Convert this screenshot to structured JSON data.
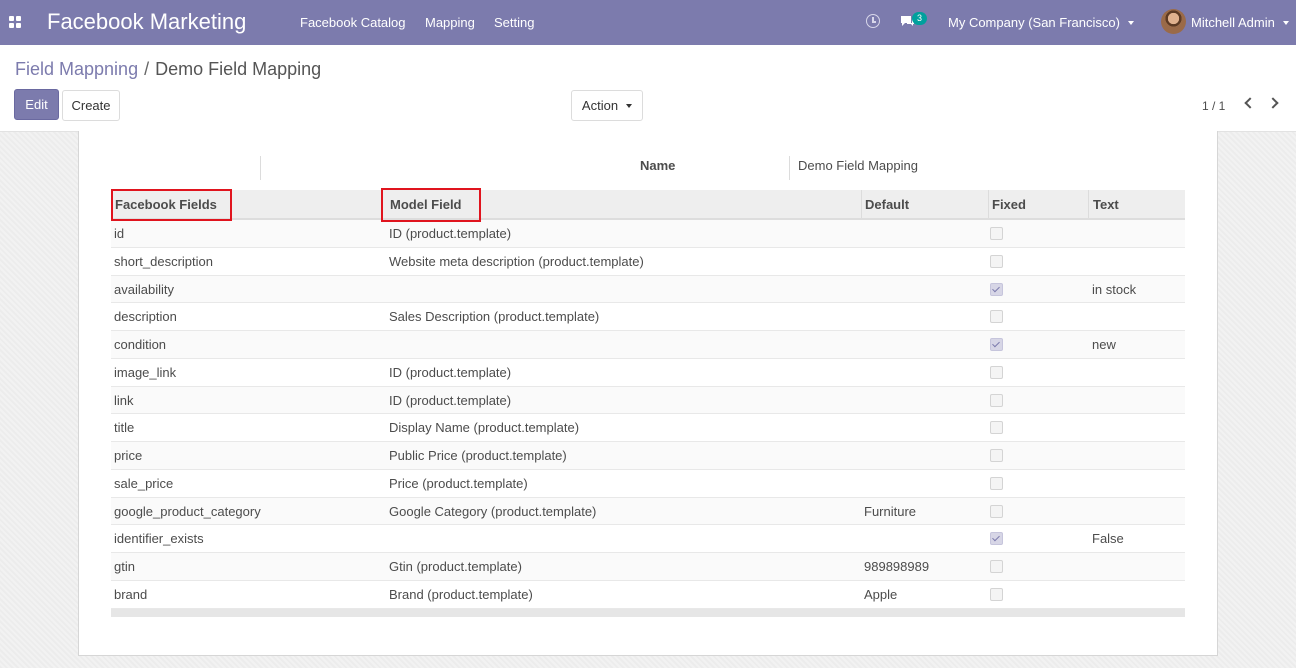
{
  "navbar": {
    "brand": "Facebook Marketing",
    "menu": [
      "Facebook Catalog",
      "Mapping",
      "Setting"
    ],
    "chat_count": "3",
    "company": "My Company (San Francisco)",
    "user": "Mitchell Admin",
    "color": "#7c7bad"
  },
  "breadcrumb": {
    "parent": "Field Mappning",
    "separator": "/",
    "current": "Demo Field Mapping"
  },
  "buttons": {
    "edit": "Edit",
    "create": "Create",
    "action": "Action"
  },
  "pager": "1 / 1",
  "form": {
    "name_label": "Name",
    "name_value": "Demo Field Mapping"
  },
  "table": {
    "headers": [
      "Facebook Fields",
      "Model Field",
      "Default",
      "Fixed",
      "Text"
    ],
    "rows": [
      {
        "facebook_field": "id",
        "model_field": "ID (product.template)",
        "default": "",
        "fixed": false,
        "text": ""
      },
      {
        "facebook_field": "short_description",
        "model_field": "Website meta description (product.template)",
        "default": "",
        "fixed": false,
        "text": ""
      },
      {
        "facebook_field": "availability",
        "model_field": "",
        "default": "",
        "fixed": true,
        "text": "in stock"
      },
      {
        "facebook_field": "description",
        "model_field": "Sales Description (product.template)",
        "default": "",
        "fixed": false,
        "text": ""
      },
      {
        "facebook_field": "condition",
        "model_field": "",
        "default": "",
        "fixed": true,
        "text": "new"
      },
      {
        "facebook_field": "image_link",
        "model_field": "ID (product.template)",
        "default": "",
        "fixed": false,
        "text": ""
      },
      {
        "facebook_field": "link",
        "model_field": "ID (product.template)",
        "default": "",
        "fixed": false,
        "text": ""
      },
      {
        "facebook_field": "title",
        "model_field": "Display Name (product.template)",
        "default": "",
        "fixed": false,
        "text": ""
      },
      {
        "facebook_field": "price",
        "model_field": "Public Price (product.template)",
        "default": "",
        "fixed": false,
        "text": ""
      },
      {
        "facebook_field": "sale_price",
        "model_field": "Price (product.template)",
        "default": "",
        "fixed": false,
        "text": ""
      },
      {
        "facebook_field": "google_product_category",
        "model_field": "Google Category (product.template)",
        "default": "Furniture",
        "fixed": false,
        "text": ""
      },
      {
        "facebook_field": "identifier_exists",
        "model_field": "",
        "default": "",
        "fixed": true,
        "text": "False"
      },
      {
        "facebook_field": "gtin",
        "model_field": "Gtin (product.template)",
        "default": "989898989",
        "fixed": false,
        "text": ""
      },
      {
        "facebook_field": "brand",
        "model_field": "Brand (product.template)",
        "default": "Apple",
        "fixed": false,
        "text": ""
      }
    ]
  },
  "highlight_color": "#e0141e"
}
